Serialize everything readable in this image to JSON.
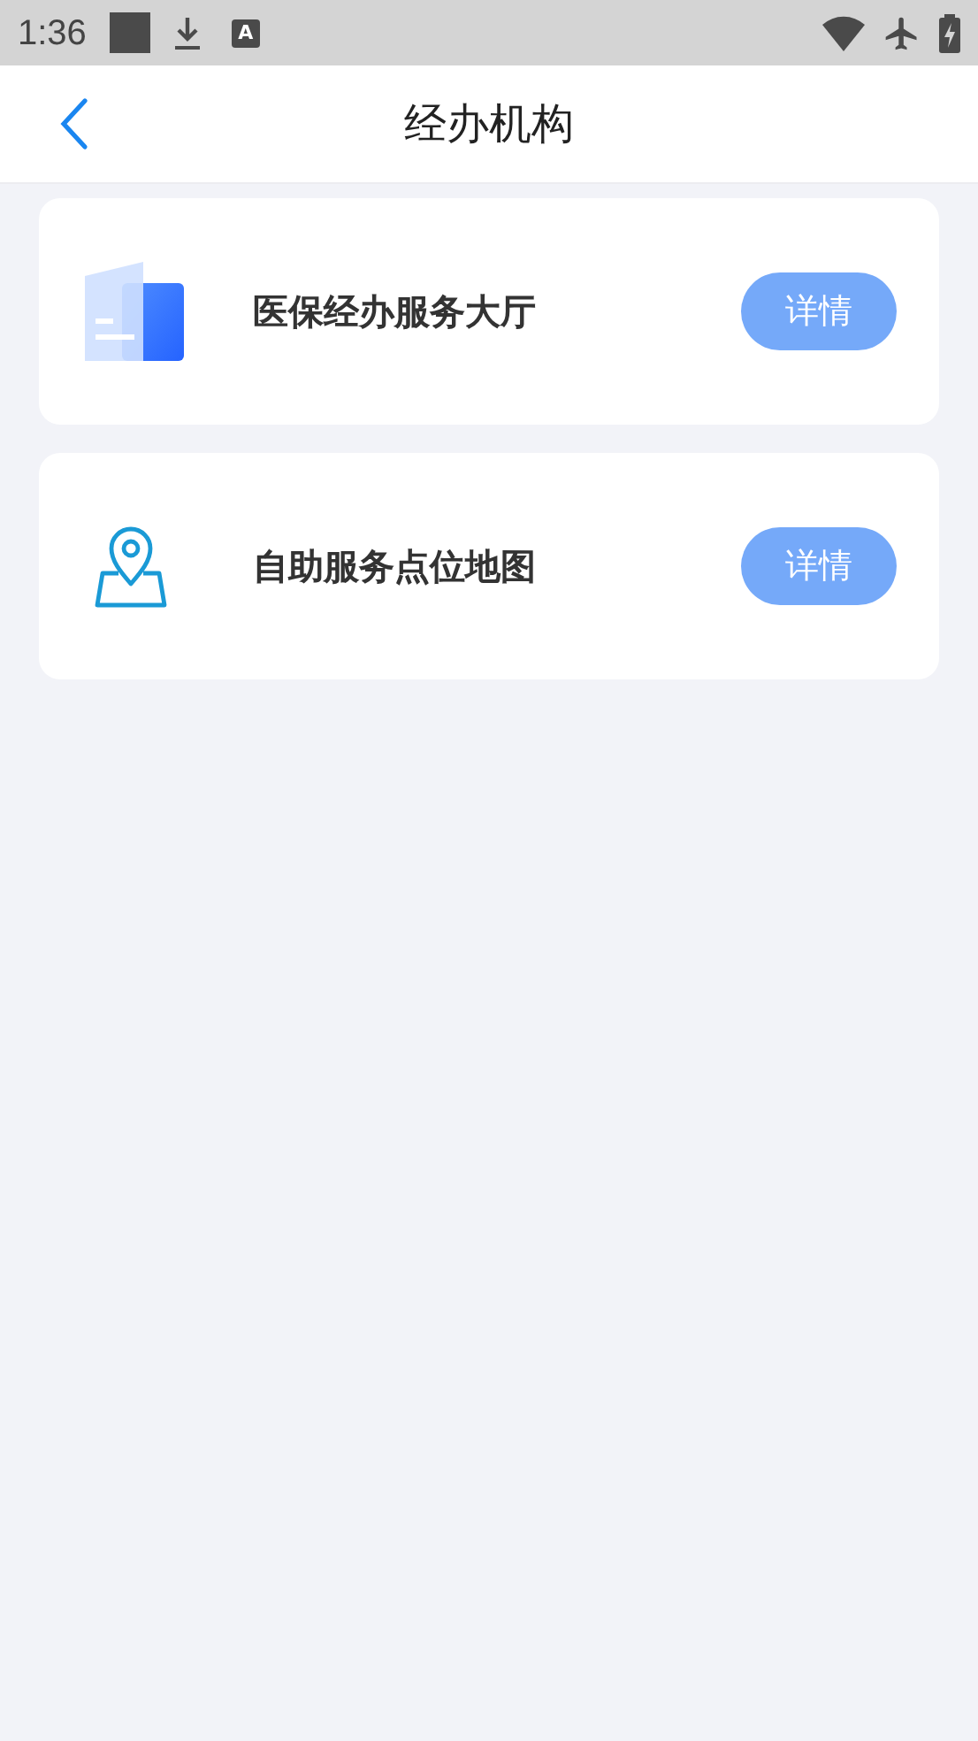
{
  "status_bar": {
    "time": "1:36",
    "badge_letter": "A"
  },
  "header": {
    "title": "经办机构"
  },
  "items": [
    {
      "kind": "building",
      "label": "医保经办服务大厅",
      "button": "详情"
    },
    {
      "kind": "map-pin",
      "label": "自助服务点位地图",
      "button": "详情"
    }
  ]
}
